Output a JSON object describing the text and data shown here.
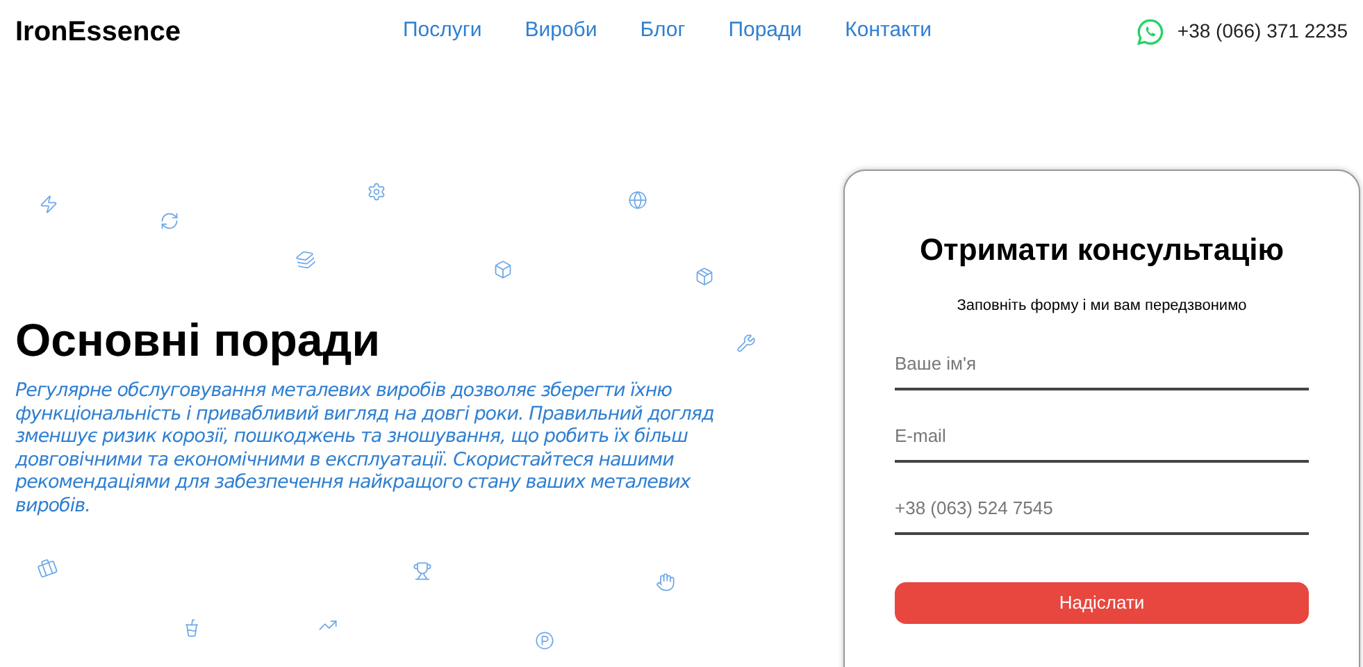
{
  "header": {
    "logo": "IronEssence",
    "nav": [
      {
        "label": "Послуги"
      },
      {
        "label": "Вироби"
      },
      {
        "label": "Блог"
      },
      {
        "label": "Поради"
      },
      {
        "label": "Контакти"
      }
    ],
    "phone": "+38 (066) 371 2235"
  },
  "hero": {
    "title": "Основні поради",
    "text": "Регулярне обслуговування металевих виробів дозволяє зберегти їхню функціональність і привабливий вигляд на довгі роки. Правильний догляд зменшує ризик корозії, пошкоджень та зношування, що робить їх більш довговічними та економічними в експлуатації. Скористайтеся нашими рекомендаціями для забезпечення найкращого стану ваших металевих виробів."
  },
  "form": {
    "title": "Отримати консультацію",
    "subtitle": "Заповніть форму і ми вам передзвонимо",
    "fields": [
      {
        "placeholder": "Ваше ім'я"
      },
      {
        "placeholder": "E-mail"
      },
      {
        "placeholder": "+38 (063) 524 7545"
      }
    ],
    "button": "Надіслати"
  }
}
